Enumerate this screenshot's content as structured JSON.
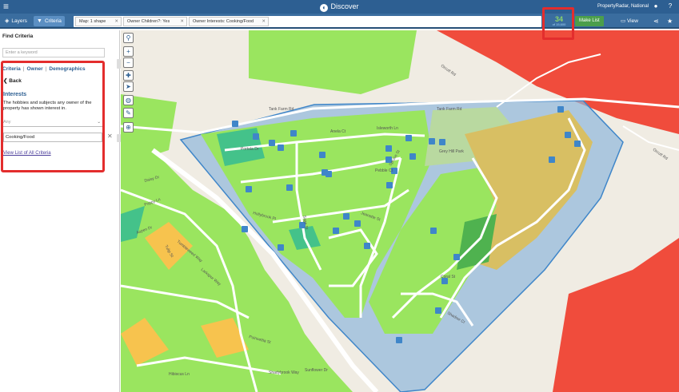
{
  "topbar": {
    "menu_icon": "hamburger-icon",
    "title": "Discover",
    "account": "PropertyRadar, National",
    "icons": [
      "user-icon",
      "help-icon"
    ]
  },
  "toolbar": {
    "layers_label": "Layers",
    "criteria_label": "Criteria",
    "chips": [
      "Map: 1 shape",
      "Owner Children?: Yes",
      "Owner Interests: Cooking/Food"
    ],
    "count": "34",
    "count_sub": "of 15,600",
    "make_list_label": "Make List",
    "view_label": "View",
    "icons": [
      "share-icon",
      "star-icon"
    ]
  },
  "panel": {
    "title": "Find Criteria",
    "keyword_placeholder": "Enter a keyword",
    "tabs": [
      "Criteria",
      "Owner",
      "Demographics"
    ],
    "back_label": "Back",
    "section_title": "Interests",
    "section_desc": "The hobbies and subjects any owner of the property has shown interest in.",
    "match_select": "Any",
    "value": "Cooking/Food",
    "view_all_link": "View List of All Criteria"
  },
  "map": {
    "tools": [
      "person-icon",
      "zoom-in-icon",
      "zoom-out-icon",
      "pin-icon",
      "locate-icon",
      "globe-icon",
      "draw-icon",
      "search-area-icon"
    ],
    "street_labels": [
      "Tank Farm Rd",
      "Tank Farm Rd",
      "Orcutt Rd",
      "Orcutt Rd",
      "Anela Ct",
      "Isleworth Ln",
      "Grey Hill Park",
      "Portola Dr",
      "Jeanette St",
      "Spruce St",
      "Pebble Ct",
      "Sage St",
      "Hollybrook Pl",
      "Coral St",
      "Shadow Ct",
      "Poinsettia St",
      "Shadybrook Way",
      "Sunflower Dr",
      "Hibiscus Ln",
      "Larkspur Way",
      "Tumbleweed Way",
      "Aspen Dr",
      "Daisy Dr",
      "Poppy Ln",
      "Tulip St"
    ],
    "colors": {
      "roads": "#ffffff",
      "red_zone": "#f04c3c",
      "lime": "#9ae55f",
      "selection_fill": "#8fb8dc",
      "selection_stroke": "#3f86c9",
      "marker": "#3f86c9"
    }
  }
}
